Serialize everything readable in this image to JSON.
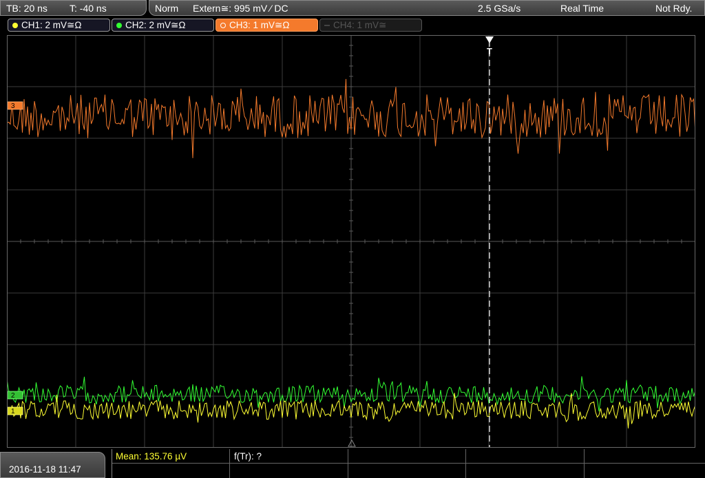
{
  "header": {
    "timebase": "TB: 20 ns",
    "trigger_offset": "T: -40 ns",
    "trigger_mode": "Norm",
    "trigger_source": "Extern≅: 995 mV ⁄ DC",
    "sample_rate": "2.5 GSa/s",
    "acquisition_mode": "Real Time",
    "status": "Not Rdy."
  },
  "channels": [
    {
      "label": "CH1: 2 mV≅Ω",
      "color": "#ffff33",
      "active": true
    },
    {
      "label": "CH2: 2 mV≅Ω",
      "color": "#33ff33",
      "active": true
    },
    {
      "label": "CH3: 1 mV≅Ω",
      "color": "#f47a2c",
      "active": true,
      "selected": true
    },
    {
      "label": "CH4: 1 mV≅",
      "color": "#555555",
      "active": false
    }
  ],
  "markers": {
    "trigger": "T",
    "ch3_marker": "3",
    "ch2_marker": "2",
    "ch1_marker": "1"
  },
  "footer": {
    "datetime": "2016-11-18 11:47",
    "mean": "Mean: 135.76 µV",
    "frequency": "f(Tr): ?"
  },
  "colors": {
    "grid": "#3c3c3c",
    "grid_center": "#5a5a5a",
    "ch1": "#ffff33",
    "ch2": "#33ff33",
    "ch3": "#f47a2c"
  }
}
